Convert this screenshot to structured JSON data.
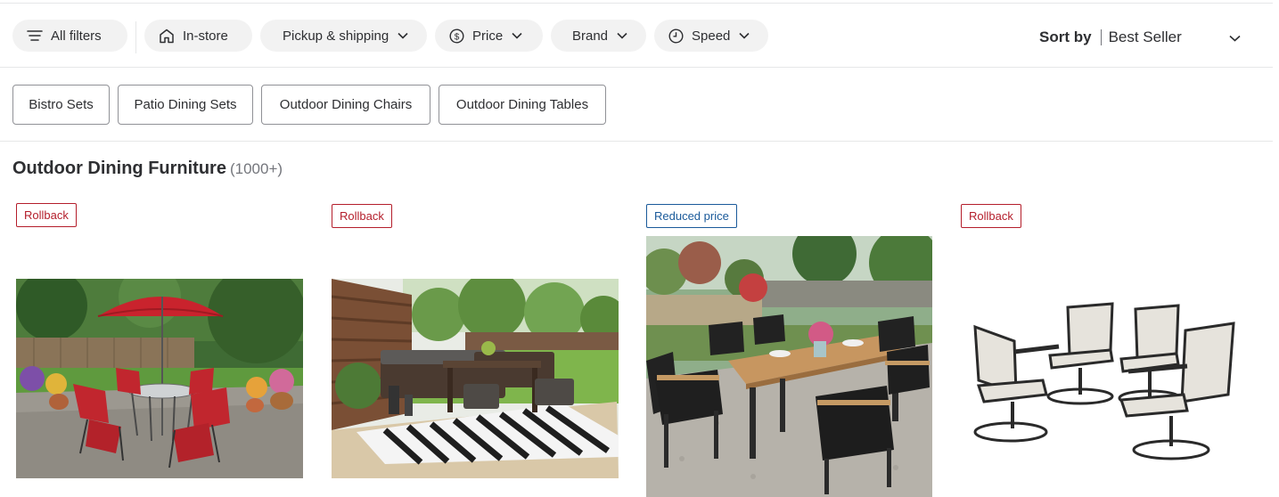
{
  "filters": {
    "all_filters": "All filters",
    "in_store": "In-store",
    "pickup_shipping": "Pickup & shipping",
    "price": "Price",
    "brand": "Brand",
    "speed": "Speed"
  },
  "sort": {
    "label": "Sort by",
    "value": "Best Seller"
  },
  "chips": [
    "Bistro Sets",
    "Patio Dining Sets",
    "Outdoor Dining Chairs",
    "Outdoor Dining Tables"
  ],
  "page": {
    "title": "Outdoor Dining Furniture",
    "count": "(1000+)"
  },
  "products": [
    {
      "badge": "Rollback",
      "badge_color": "#b41e2b",
      "image": "red-patio-set-with-umbrella-image"
    },
    {
      "badge": "Rollback",
      "badge_color": "#b41e2b",
      "image": "wicker-sectional-dining-set-image"
    },
    {
      "badge": "Reduced price",
      "badge_color": "#1a5a9a",
      "image": "acacia-dining-table-set-image"
    },
    {
      "badge": "Rollback",
      "badge_color": "#b41e2b",
      "image": "swivel-sling-chairs-image"
    }
  ],
  "colors": {
    "pill_bg": "#f2f2f2",
    "rollback": "#b41e2b",
    "reduced": "#1a5a9a",
    "text": "#2e2f32"
  }
}
